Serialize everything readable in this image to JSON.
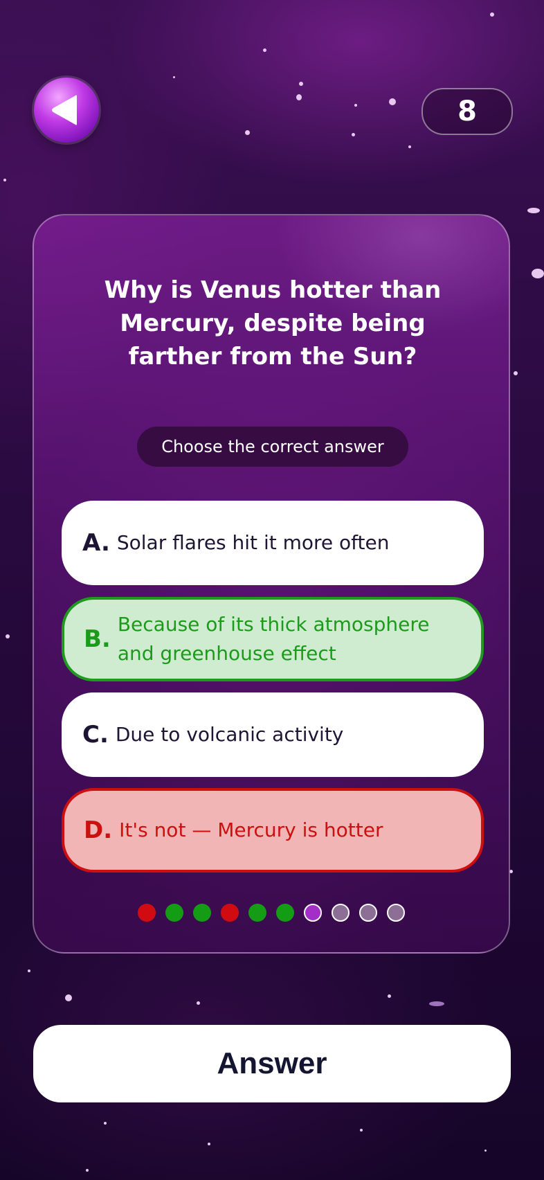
{
  "header": {
    "counter": "8"
  },
  "quiz": {
    "question": "Why is Venus hotter than Mercury, despite being farther from the Sun?",
    "hint": "Choose the correct answer",
    "options": [
      {
        "letter": "A.",
        "text": "Solar flares hit it more often",
        "state": "default"
      },
      {
        "letter": "B.",
        "text": "Because of its thick atmosphere and greenhouse effect",
        "state": "correct"
      },
      {
        "letter": "C.",
        "text": "Due to volcanic activity",
        "state": "default"
      },
      {
        "letter": "D.",
        "text": "It's not — Mercury is hotter",
        "state": "wrong"
      }
    ],
    "progress": [
      "wrong",
      "right",
      "right",
      "wrong",
      "right",
      "right",
      "current",
      "pending",
      "pending",
      "pending"
    ]
  },
  "footer": {
    "answer_label": "Answer"
  },
  "colors": {
    "correct": "#149d14",
    "wrong": "#d00c12",
    "current": "#a32ec8"
  }
}
